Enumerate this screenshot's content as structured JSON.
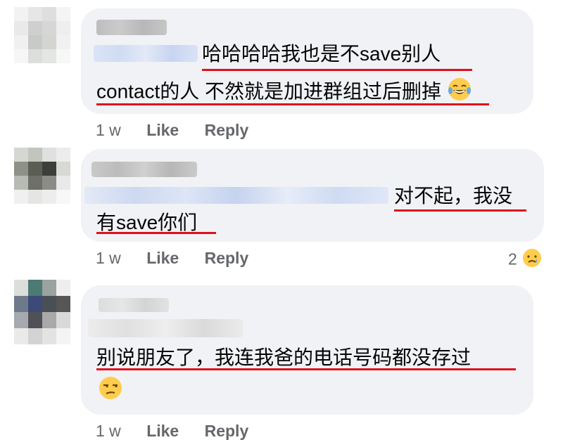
{
  "comments": [
    {
      "line1": "哈哈哈哈我也是不save别人",
      "line2": "contact的人 不然就是加进群组过后删掉",
      "emoji": "grinning-with-tears",
      "time": "1 w",
      "like": "Like",
      "reply": "Reply"
    },
    {
      "line1": "对不起，我没",
      "line2": "有save你们",
      "time": "1 w",
      "like": "Like",
      "reply": "Reply",
      "reaction_count": "2",
      "reaction_emoji": "sad-tear"
    },
    {
      "line1": "别说朋友了，我连我爸的电话号码都没存过",
      "emoji": "unamused",
      "time": "1 w",
      "like": "Like",
      "reply": "Reply"
    }
  ],
  "colors": {
    "underline": "#e0101b",
    "bubble": "#f0f2f5",
    "meta_text": "#65676b"
  }
}
